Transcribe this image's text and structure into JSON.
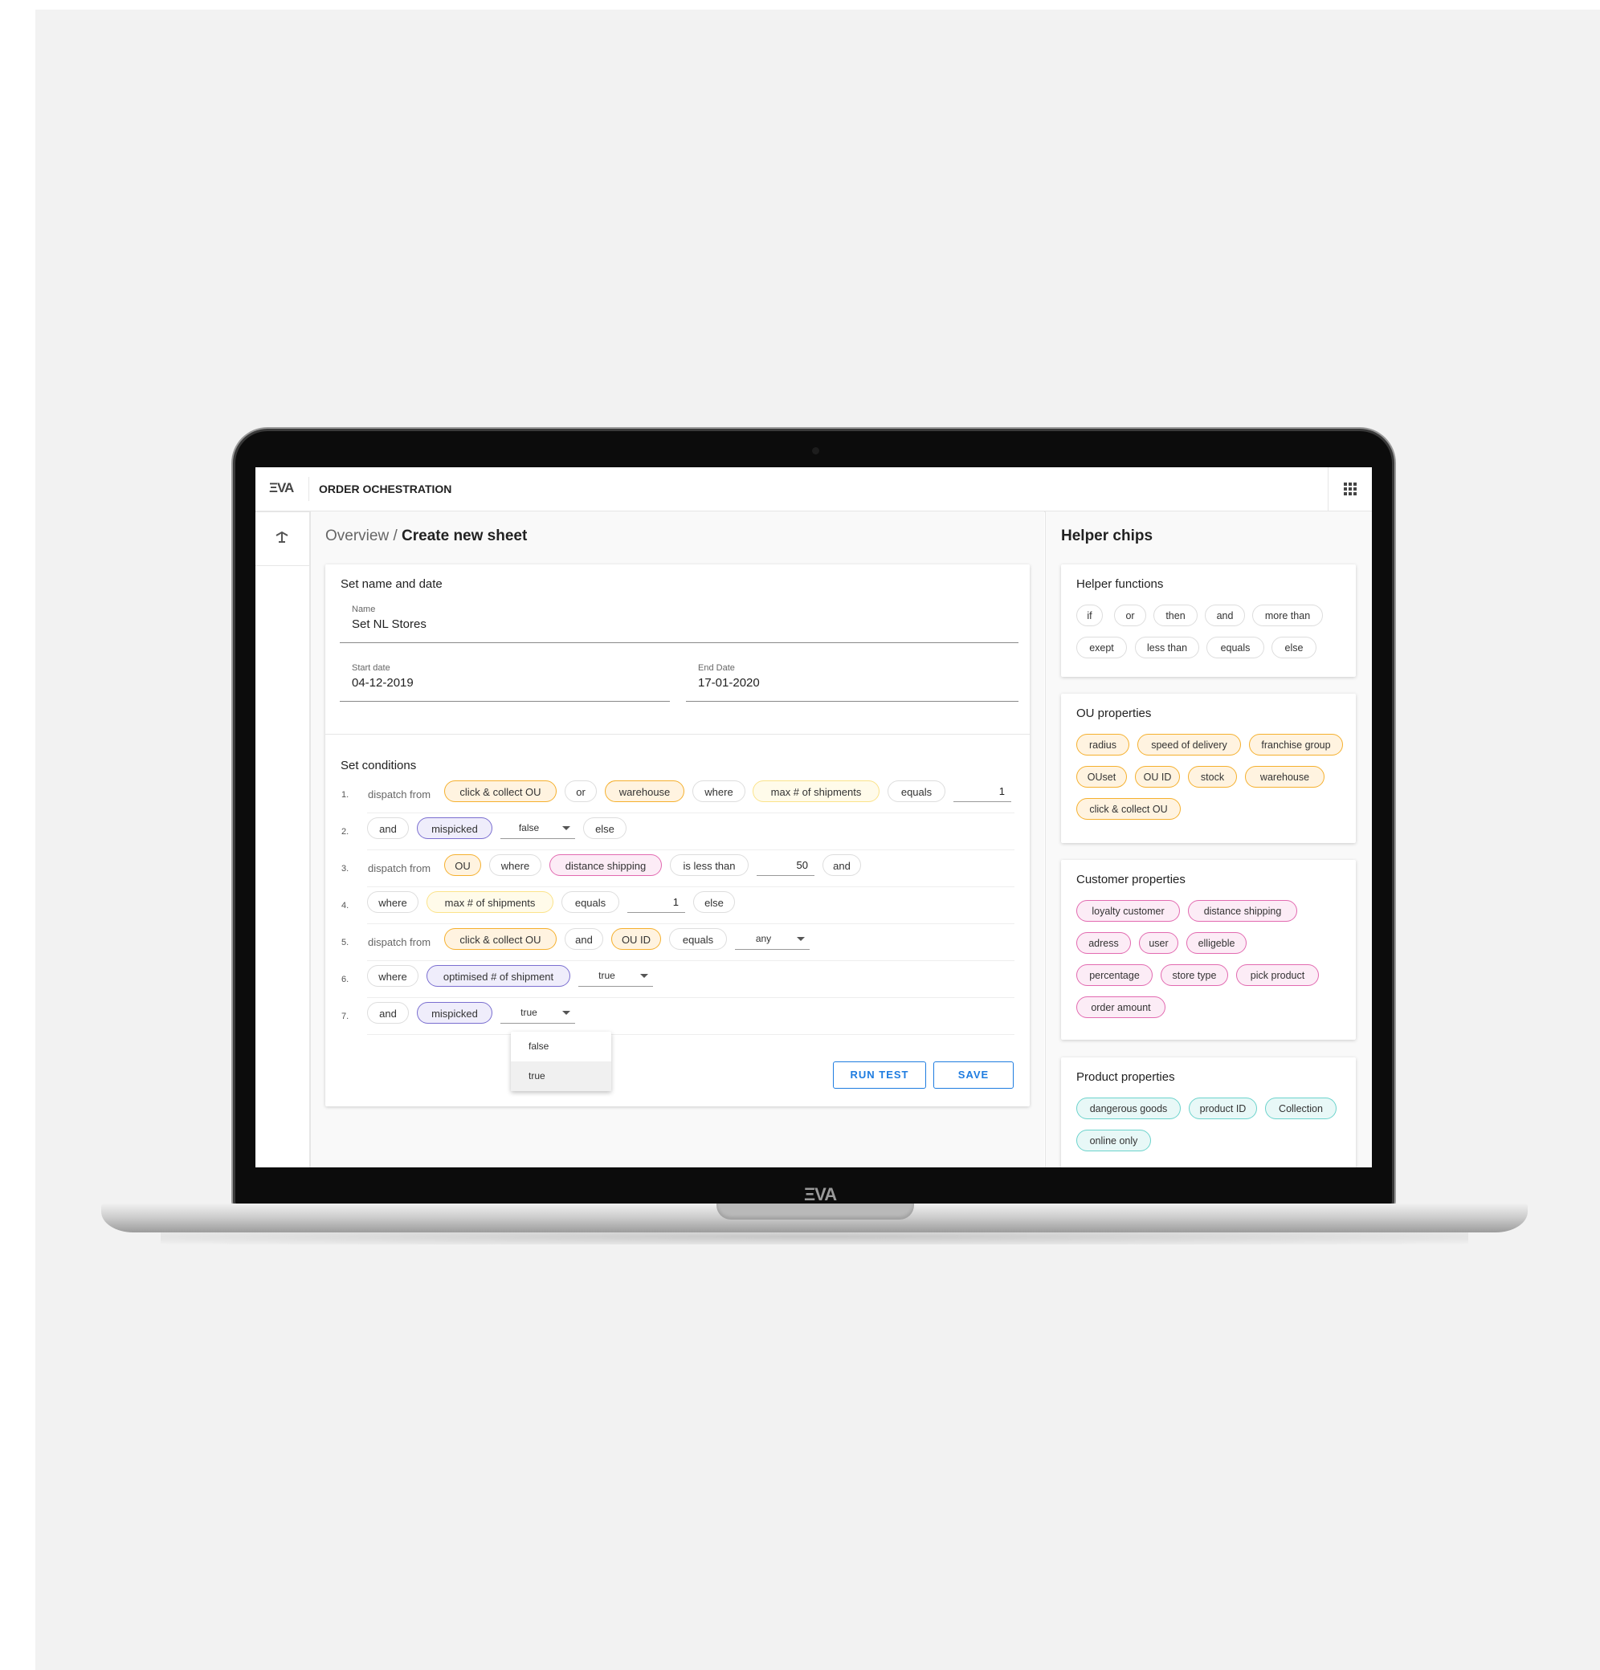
{
  "app": {
    "logo": "ΞVA",
    "title": "ORDER OCHESTRATION",
    "grid_icon": "apps-grid-icon"
  },
  "sidebar": {
    "icon": "route-icon"
  },
  "breadcrumb": {
    "parent": "Overview /",
    "current": "Create new sheet"
  },
  "form": {
    "section_title": "Set name and date",
    "name": {
      "label": "Name",
      "value": "Set NL Stores"
    },
    "start_date": {
      "label": "Start date",
      "value": "04-12-2019"
    },
    "end_date": {
      "label": "End Date",
      "value": "17-01-2020"
    }
  },
  "conditions": {
    "title": "Set conditions",
    "rows": [
      {
        "num": "1.",
        "items": [
          "dispatch from",
          "click & collect OU",
          "or",
          "warehouse",
          "where",
          "max # of shipments",
          "equals",
          "1"
        ]
      },
      {
        "num": "2.",
        "items": [
          "and",
          "mispicked",
          "false",
          "else"
        ]
      },
      {
        "num": "3.",
        "items": [
          "dispatch from",
          "OU",
          "where",
          "distance shipping",
          "is less than",
          "50",
          "and"
        ]
      },
      {
        "num": "4.",
        "items": [
          "where",
          "max # of shipments",
          "equals",
          "1",
          "else"
        ]
      },
      {
        "num": "5.",
        "items": [
          "dispatch from",
          "click & collect OU",
          "and",
          "OU ID",
          "equals",
          "any"
        ]
      },
      {
        "num": "6.",
        "items": [
          "where",
          "optimised # of shipment",
          "true"
        ]
      },
      {
        "num": "7.",
        "items": [
          "and",
          "mispicked",
          "true"
        ]
      }
    ],
    "dropdown_options": [
      "false",
      "true"
    ],
    "dropdown_selected": "true"
  },
  "actions": {
    "run_test": "RUN TEST",
    "save": "SAVE"
  },
  "helper": {
    "title": "Helper chips",
    "functions": {
      "title": "Helper functions",
      "chips": [
        "if",
        "or",
        "then",
        "and",
        "more than",
        "exept",
        "less than",
        "equals",
        "else"
      ]
    },
    "ou": {
      "title": "OU properties",
      "chips": [
        "radius",
        "speed of delivery",
        "franchise group",
        "OUset",
        "OU ID",
        "stock",
        "warehouse",
        "click & collect OU"
      ]
    },
    "customer": {
      "title": "Customer properties",
      "chips": [
        "loyalty customer",
        "distance shipping",
        "adress",
        "user",
        "elligeble",
        "percentage",
        "store type",
        "pick product",
        "order amount"
      ]
    },
    "product": {
      "title": "Product properties",
      "chips": [
        "dangerous goods",
        "product ID",
        "Collection",
        "online only"
      ]
    }
  },
  "colors": {
    "accent": "#1e7ce0",
    "ou": "#f5b02e",
    "max": "#fbe38a",
    "boolean": "#7a6ed0",
    "customer": "#e26ab0",
    "product": "#6cd3cc"
  }
}
